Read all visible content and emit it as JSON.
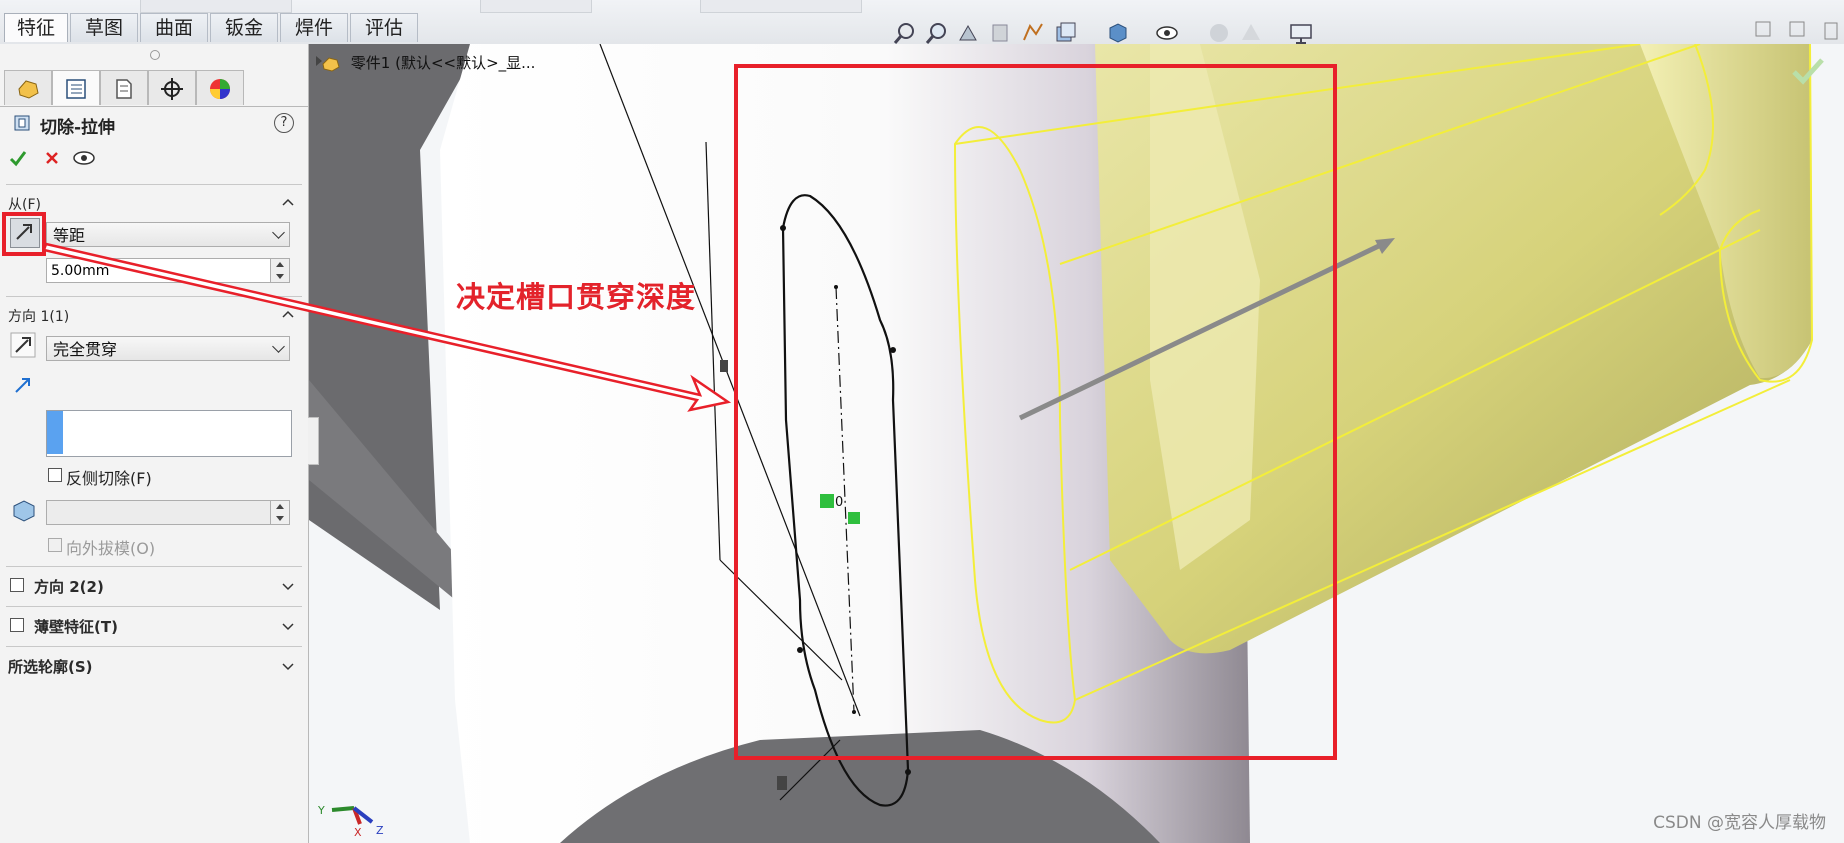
{
  "tabs": [
    "特征",
    "草图",
    "曲面",
    "钣金",
    "焊件",
    "评估"
  ],
  "active_tab": "特征",
  "panel": {
    "feature_title": "切除-拉伸",
    "help_label": "?",
    "from": {
      "header": "从(F)",
      "type_value": "等距",
      "offset_value": "5.00mm"
    },
    "direction1": {
      "header": "方向 1(1)",
      "end_condition": "完全贯穿",
      "flip_side_label": "反侧切除(F)",
      "draft_outward_label": "向外拔模(O)"
    },
    "direction2": {
      "header": "方向 2(2)"
    },
    "thin_feature": {
      "header": "薄壁特征(T)"
    },
    "selected_contours": {
      "header": "所选轮廓(S)"
    }
  },
  "tree": {
    "root_label": "零件1 (默认<<默认>_显..."
  },
  "annotation": {
    "text": "决定槽口贯穿深度",
    "color": "#e3232b"
  },
  "triad": {
    "y": "Y",
    "x": "X",
    "z": "Z"
  },
  "sketch_labels": {
    "origin": "0"
  },
  "watermark": "CSDN @宽容人厚载物",
  "colors": {
    "accent_red": "#e8202a",
    "selection_blue": "#5aa2f0",
    "preview_yellow": "#f4f07a",
    "part_gray": "#6f6f72"
  }
}
